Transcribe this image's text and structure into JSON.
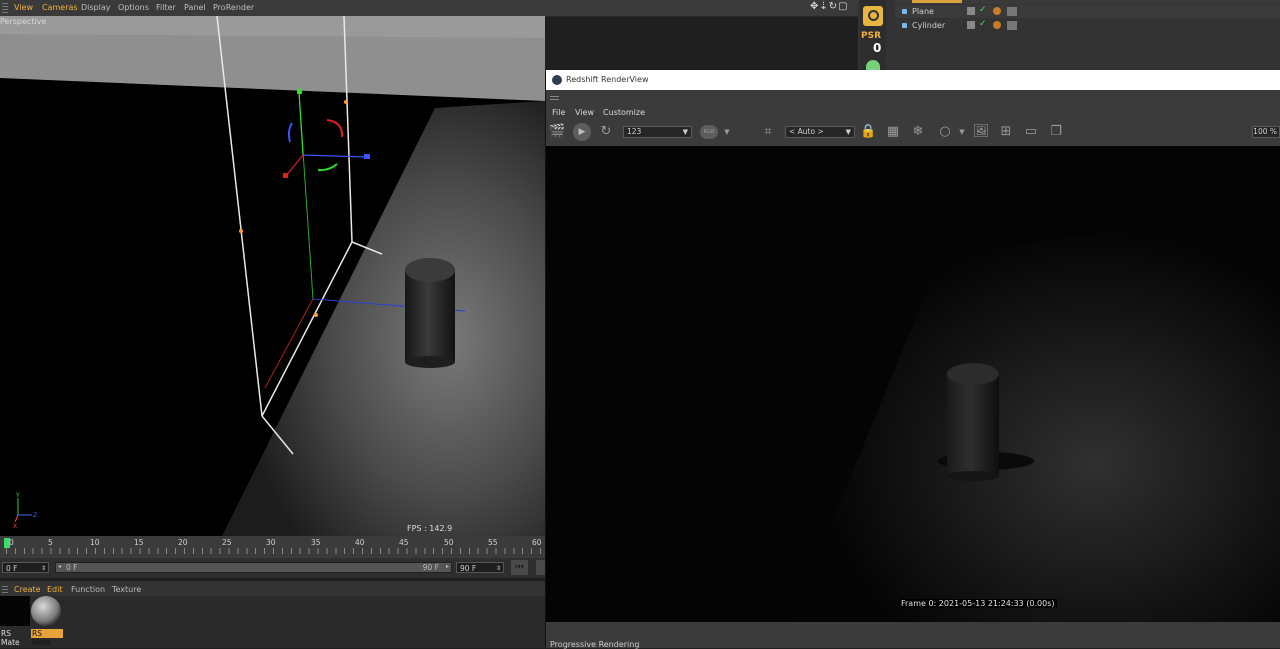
{
  "viewport_menu": {
    "items": [
      "View",
      "Cameras",
      "Display",
      "Options",
      "Filter",
      "Panel",
      "ProRender"
    ]
  },
  "viewport": {
    "label": "Perspective",
    "fps": "FPS : 142.9"
  },
  "object_manager": {
    "psr_label": "PSR",
    "psr_value": "0",
    "rows": [
      "Plane",
      "Cylinder"
    ]
  },
  "timeline": {
    "ticks": [
      "0",
      "5",
      "10",
      "15",
      "20",
      "25",
      "30",
      "35",
      "40",
      "45",
      "50",
      "55",
      "60"
    ],
    "start_field": "0 F",
    "range_start": "0 F",
    "range_end": "90 F",
    "end_field": "90 F"
  },
  "material_manager": {
    "menu": [
      "Create",
      "Edit",
      "Function",
      "Texture"
    ],
    "materials": [
      "RS Mate",
      "RS Mate"
    ]
  },
  "renderview": {
    "title": "Redshift RenderView",
    "menu": [
      "File",
      "View",
      "Customize"
    ],
    "snapshot_select": "123",
    "camera_select": "< Auto >",
    "zoom": "100 %",
    "frame_info": "Frame  0:  2021-05-13  21:24:33  (0.00s)",
    "status": "Progressive Rendering"
  },
  "colors": {
    "accent": "#f2b13b",
    "playhead": "#3ddc68"
  }
}
